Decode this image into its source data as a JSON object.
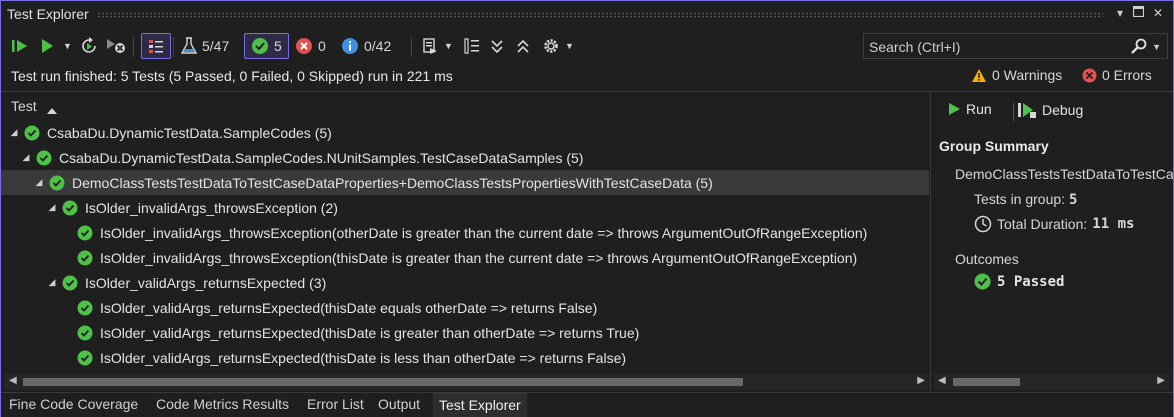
{
  "window": {
    "title": "Test Explorer"
  },
  "toolbar": {
    "test_count": "5/47",
    "passed_count": "5",
    "failed_count": "0",
    "not_run_count": "0/42",
    "search_placeholder": "Search (Ctrl+I)"
  },
  "status": {
    "message": "Test run finished: 5 Tests (5 Passed, 0 Failed, 0 Skipped) run in 221 ms",
    "warnings": "0 Warnings",
    "errors": "0 Errors"
  },
  "tree": {
    "column_header": "Test",
    "rows": [
      {
        "label": "CsabaDu.DynamicTestData.SampleCodes",
        "count": "(5)"
      },
      {
        "label": "CsabaDu.DynamicTestData.SampleCodes.NUnitSamples.TestCaseDataSamples",
        "count": "(5)"
      },
      {
        "label": "DemoClassTestsTestDataToTestCaseDataProperties+DemoClassTestsPropertiesWithTestCaseData",
        "count": "(5)"
      },
      {
        "label": "IsOlder_invalidArgs_throwsException",
        "count": "(2)"
      },
      {
        "label": "IsOlder_invalidArgs_throwsException(otherDate is greater than the current date => throws ArgumentOutOfRangeException)",
        "count": ""
      },
      {
        "label": "IsOlder_invalidArgs_throwsException(thisDate is greater than the current date => throws ArgumentOutOfRangeException)",
        "count": ""
      },
      {
        "label": "IsOlder_validArgs_returnsExpected",
        "count": "(3)"
      },
      {
        "label": "IsOlder_validArgs_returnsExpected(thisDate equals otherDate => returns False)",
        "count": ""
      },
      {
        "label": "IsOlder_validArgs_returnsExpected(thisDate is greater than otherDate => returns True)",
        "count": ""
      },
      {
        "label": "IsOlder_validArgs_returnsExpected(thisDate is less than otherDate => returns False)",
        "count": ""
      }
    ]
  },
  "details": {
    "run_label": "Run",
    "debug_label": "Debug",
    "group_summary_title": "Group Summary",
    "group_name": "DemoClassTestsTestDataToTestCaseDataProperties+DemoClassTestsPropertiesWithTestCaseData",
    "tests_in_group_label": "Tests in group:",
    "tests_in_group_value": "5",
    "total_duration_label": "Total Duration:",
    "total_duration_value": "11 ms",
    "outcomes_label": "Outcomes",
    "passed_label": "5 Passed"
  },
  "bottom_tabs": [
    "Fine Code Coverage",
    "Code Metrics Results",
    "Error List",
    "Output",
    "Test Explorer"
  ],
  "colors": {
    "accent": "#7a6ee6",
    "pass": "#4ec248",
    "fail": "#e05252",
    "info": "#3f8fe0",
    "warn": "#f0b400"
  }
}
